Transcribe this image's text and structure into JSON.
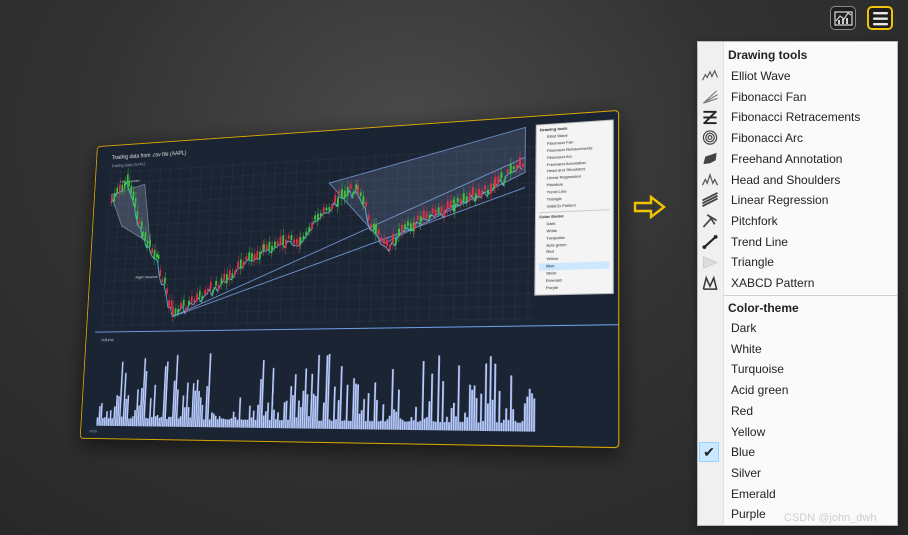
{
  "toolbar": {
    "chart_button_icon": "chart-icon",
    "menu_button_icon": "hamburger-menu-icon"
  },
  "thumbnail": {
    "title": "Trading data from .csv file (AAPL)",
    "subtitle": "Trading Data (AAPL)",
    "volume_label": "Volume",
    "year_left": "2016",
    "menu_header": "Drawing tools",
    "menu_theme_header": "Color theme",
    "annotations": [
      "Left Shoulder",
      "Right Shoulder"
    ]
  },
  "menu": {
    "drawing_header": "Drawing tools",
    "drawing_items": [
      {
        "label": "Elliot Wave",
        "icon": "elliot-wave-icon"
      },
      {
        "label": "Fibonacci Fan",
        "icon": "fibonacci-fan-icon"
      },
      {
        "label": "Fibonacci Retracements",
        "icon": "fibonacci-retracements-icon"
      },
      {
        "label": "Fibonacci Arc",
        "icon": "fibonacci-arc-icon"
      },
      {
        "label": "Freehand Annotation",
        "icon": "freehand-annotation-icon"
      },
      {
        "label": "Head and Shoulders",
        "icon": "head-and-shoulders-icon"
      },
      {
        "label": "Linear Regression",
        "icon": "linear-regression-icon"
      },
      {
        "label": "Pitchfork",
        "icon": "pitchfork-icon"
      },
      {
        "label": "Trend Line",
        "icon": "trend-line-icon"
      },
      {
        "label": "Triangle",
        "icon": "triangle-icon"
      },
      {
        "label": "XABCD Pattern",
        "icon": "xabcd-pattern-icon"
      }
    ],
    "theme_header": "Color-theme",
    "theme_items": [
      {
        "label": "Dark",
        "checked": false
      },
      {
        "label": "White",
        "checked": false
      },
      {
        "label": "Turquoise",
        "checked": false
      },
      {
        "label": "Acid green",
        "checked": false
      },
      {
        "label": "Red",
        "checked": false
      },
      {
        "label": "Yellow",
        "checked": false
      },
      {
        "label": "Blue",
        "checked": true
      },
      {
        "label": "Silver",
        "checked": false
      },
      {
        "label": "Emerald",
        "checked": false
      },
      {
        "label": "Purple",
        "checked": false
      }
    ]
  },
  "watermark": "CSDN @john_dwh",
  "colors": {
    "accent_yellow": "#f0c400",
    "chart_bg": "#1b2433",
    "up_candle": "#3fc43f",
    "down_candle": "#e0304a",
    "channel_blue": "#7fa8e6",
    "volume_bar": "#b8ccff",
    "check_bg": "#cce8ff"
  }
}
